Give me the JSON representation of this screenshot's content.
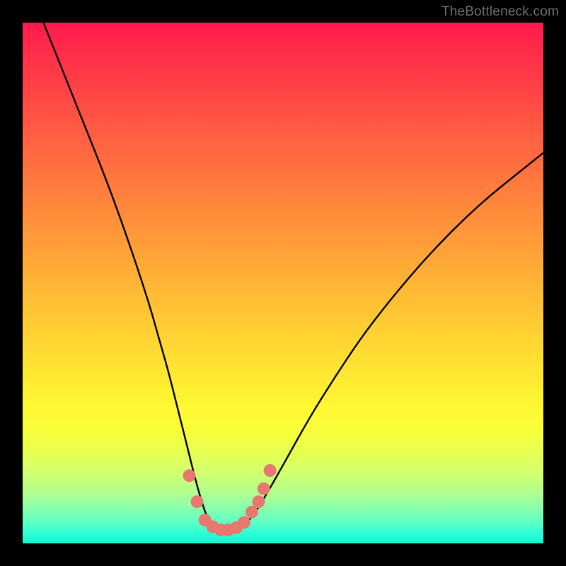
{
  "watermark": {
    "text": "TheBottleneck.com"
  },
  "colors": {
    "background": "#000000",
    "curve_stroke": "#000000",
    "dot_fill": "#e8786f",
    "dot_stroke": "#c65a52"
  },
  "chart_data": {
    "type": "line",
    "title": "",
    "xlabel": "",
    "ylabel": "",
    "xlim": [
      0,
      100
    ],
    "ylim": [
      0,
      100
    ],
    "note": "No axes, ticks, or labels are rendered; values are positions read off the plot area (0–100 scale).",
    "series": [
      {
        "name": "bottleneck-curve",
        "x": [
          4,
          8,
          12,
          16,
          20,
          24,
          26,
          28,
          30,
          32,
          33.5,
          35,
          36,
          37,
          38.5,
          40,
          42,
          44,
          46,
          50,
          55,
          60,
          65,
          70,
          75,
          80,
          85,
          90,
          95,
          100
        ],
        "y": [
          100,
          90,
          80,
          70,
          59,
          47,
          40,
          33,
          25,
          17,
          11,
          6,
          4,
          2.8,
          2.2,
          2.2,
          3,
          5,
          8,
          15,
          24,
          32,
          39.5,
          46,
          52,
          57.5,
          62.5,
          67,
          71,
          75
        ]
      }
    ],
    "dots": {
      "name": "highlight-dots",
      "points": [
        {
          "x": 32.0,
          "y": 13.0
        },
        {
          "x": 33.5,
          "y": 8.0
        },
        {
          "x": 35.0,
          "y": 4.5
        },
        {
          "x": 36.5,
          "y": 3.2
        },
        {
          "x": 38.0,
          "y": 2.6
        },
        {
          "x": 39.5,
          "y": 2.6
        },
        {
          "x": 41.0,
          "y": 3.0
        },
        {
          "x": 42.5,
          "y": 4.0
        },
        {
          "x": 44.0,
          "y": 6.0
        },
        {
          "x": 45.3,
          "y": 8.0
        },
        {
          "x": 46.3,
          "y": 10.5
        },
        {
          "x": 47.5,
          "y": 14.0
        }
      ]
    }
  }
}
